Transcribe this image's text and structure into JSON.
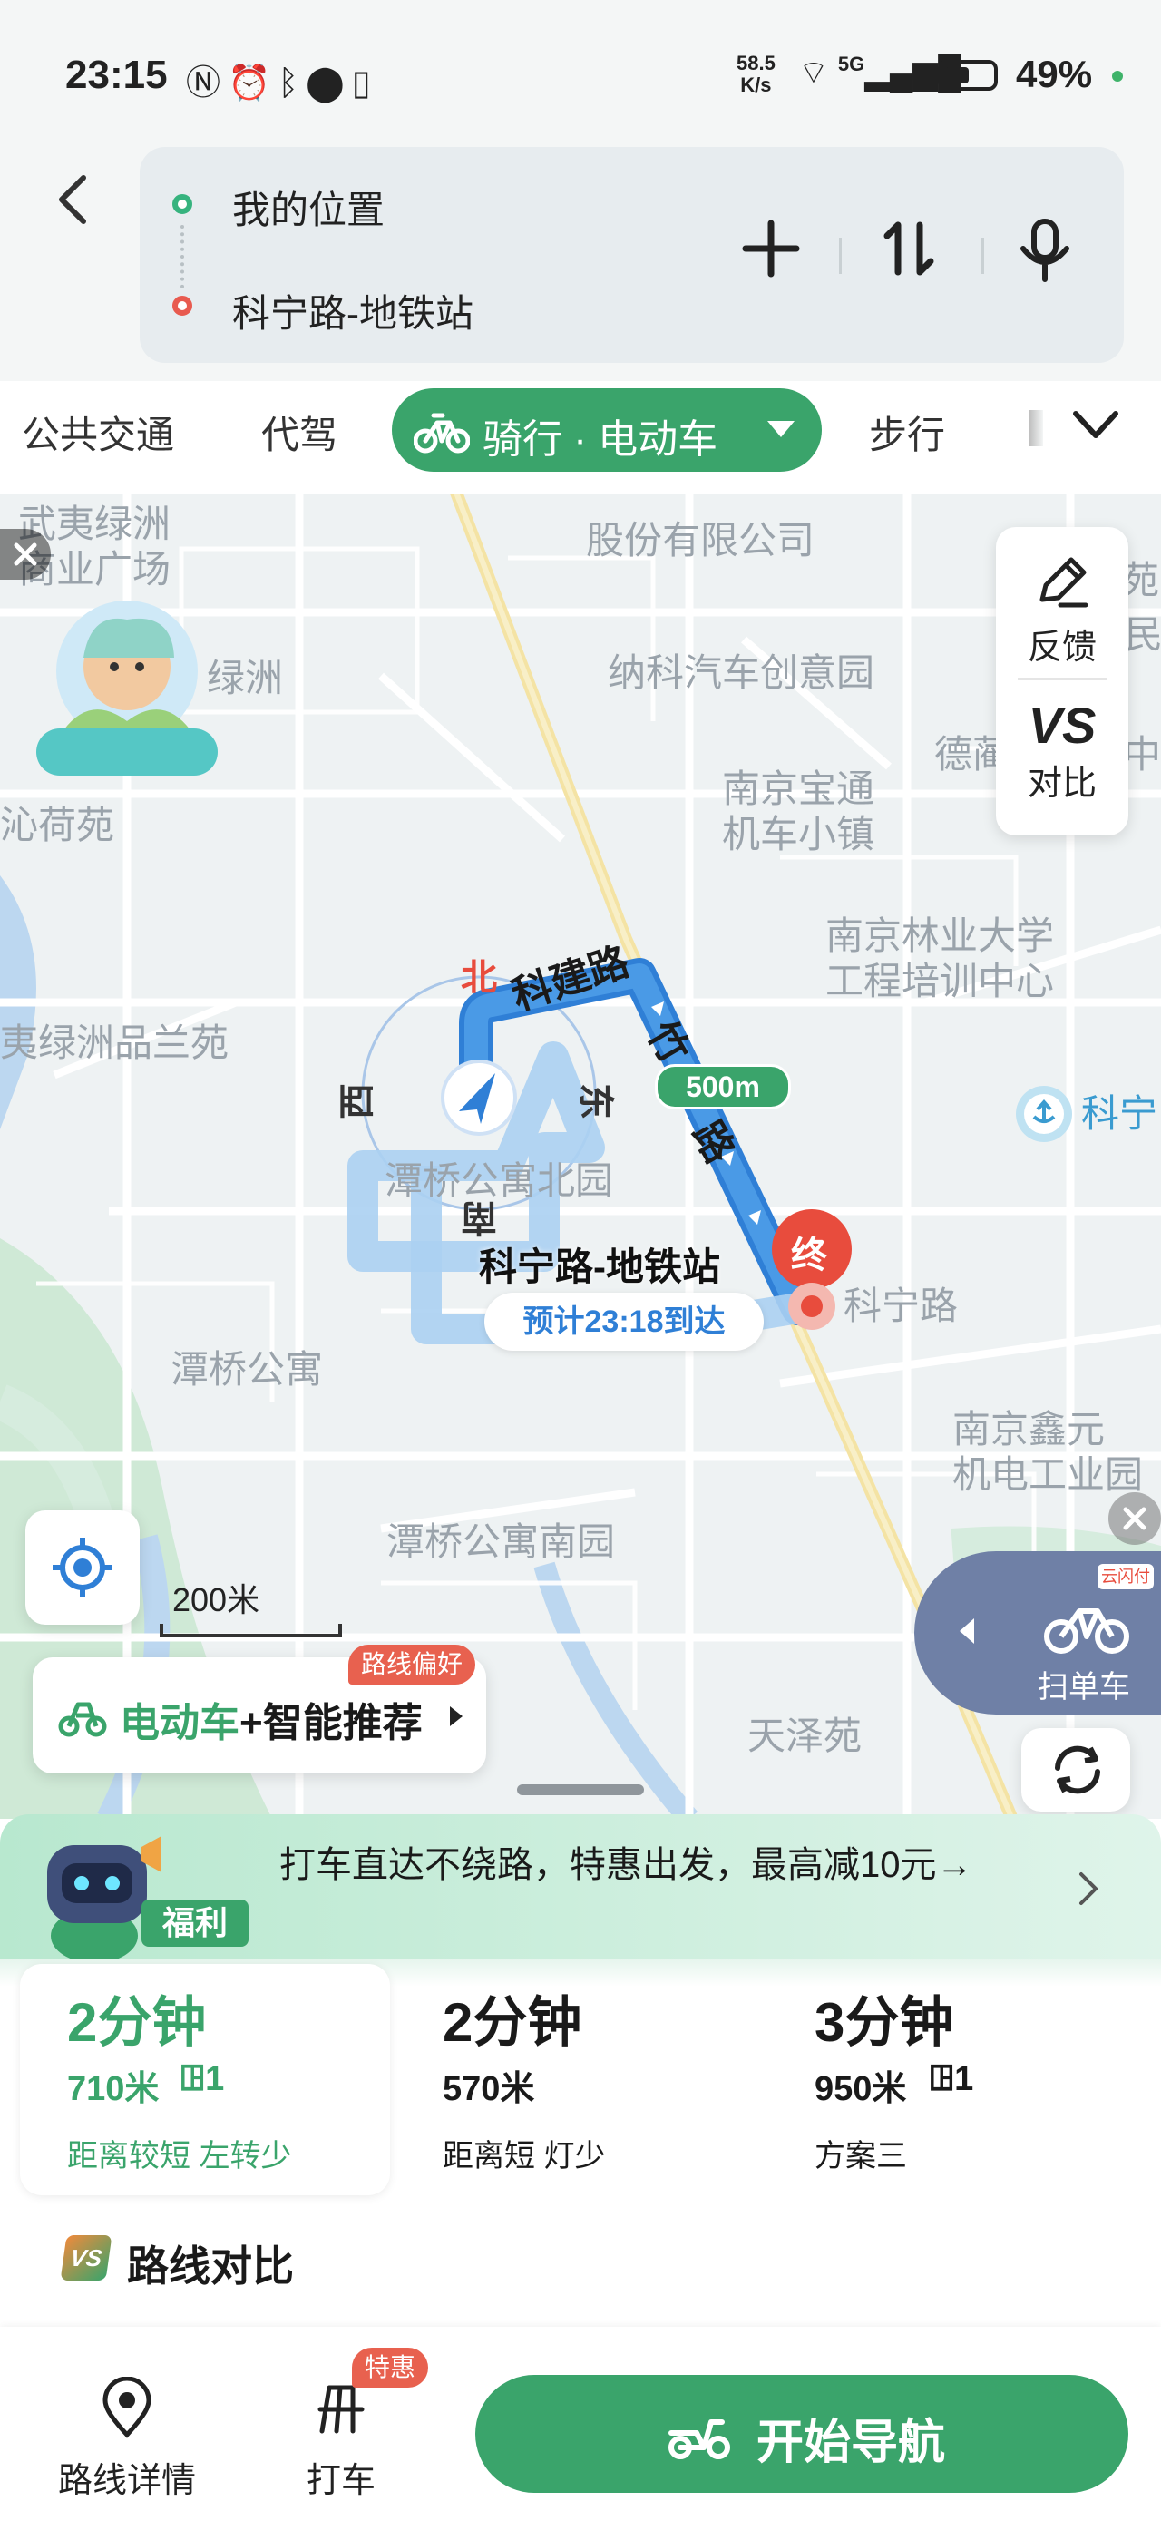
{
  "status_bar": {
    "time": "23:15",
    "net_speed_value": "58.5",
    "net_speed_unit": "K/s",
    "network_type": "5G",
    "battery": "49%"
  },
  "route_input": {
    "origin": "我的位置",
    "destination": "科宁路-地铁站"
  },
  "mode_tabs": [
    {
      "label": "公共交通"
    },
    {
      "label": "代驾"
    },
    {
      "label": "骑行 · 电动车",
      "active": true
    },
    {
      "label": "步行"
    }
  ],
  "map": {
    "labels": {
      "wuyi_lvzhou_biz": "武夷绿洲\n商业广场",
      "company": "股份有限公司",
      "naker": "纳科汽车创意园",
      "lvzhou": "绿洲",
      "qinhe_yuan": "沁荷苑",
      "baotong": "南京宝通\n机车小镇",
      "deke": "德蔺",
      "zhong": "中",
      "forestry": "南京林业大学\n工程培训中心",
      "pinlan": "夷绿洲品兰苑",
      "tanqiao_north": "潭桥公寓北园",
      "tanqiao": "潭桥公寓",
      "xinyuan": "南京鑫元\n机电工业园",
      "tanqiao_south": "潭桥公寓南园",
      "tianze": "天泽苑",
      "kening_metro_partial": "科宁",
      "kening_road": "科宁路",
      "yuan": "苑",
      "min": "民"
    },
    "road_labels": {
      "kejian": "科建路",
      "zhu": "竹",
      "lu": "路"
    },
    "compass": {
      "north": "北",
      "south": "南",
      "east": "东",
      "west": "西"
    },
    "distance_badge": "500m",
    "end_marker": "终",
    "destination_name": "科宁路-地铁站",
    "eta": "预计23:18到达",
    "scale": "200米"
  },
  "side_tools": {
    "feedback": "反馈",
    "compare_icon_text": "VS",
    "compare": "对比",
    "scan_bike": "扫单车",
    "scan_badge": "云闪付"
  },
  "preference": {
    "badge": "路线偏好",
    "label_main": "电动车",
    "label_rest": "+智能推荐"
  },
  "promo": {
    "badge": "福利",
    "text": "打车直达不绕路，特惠出发，最高减10元→"
  },
  "routes": [
    {
      "time": "2分钟",
      "distance": "710米",
      "lights": "1",
      "desc": "距离较短 左转少",
      "selected": true
    },
    {
      "time": "2分钟",
      "distance": "570米",
      "lights": "",
      "desc": "距离短 灯少",
      "selected": false
    },
    {
      "time": "3分钟",
      "distance": "950米",
      "lights": "1",
      "desc": "方案三",
      "selected": false
    }
  ],
  "route_compare": {
    "icon_text": "VS",
    "label": "路线对比"
  },
  "bottom_bar": {
    "details": "路线详情",
    "taxi": "打车",
    "taxi_badge": "特惠",
    "start_nav": "开始导航"
  },
  "colors": {
    "accent_green": "#3aa46b",
    "route_blue": "#3d8fdc",
    "end_red": "#e84c3d",
    "promo_green": "#b8e8cf"
  }
}
